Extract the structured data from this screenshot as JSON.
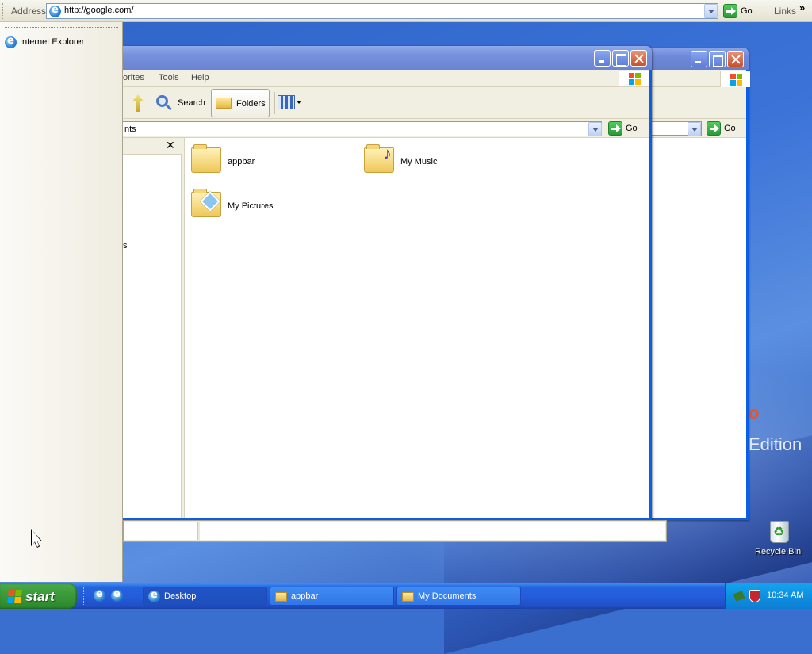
{
  "address_band": {
    "label": "Address",
    "url": "http://google.com/",
    "go_label": "Go",
    "links_label": "Links",
    "more_chevron": "»"
  },
  "appbar": {
    "items": [
      {
        "label": "Internet Explorer",
        "icon": "ie-icon"
      }
    ]
  },
  "explorer_front": {
    "menu": [
      {
        "label": "orites"
      },
      {
        "label": "Tools"
      },
      {
        "label": "Help"
      }
    ],
    "toolbar": {
      "search_label": "Search",
      "folders_label": "Folders"
    },
    "address": {
      "value": "nts",
      "go_label": "Go"
    },
    "folder_pane": {
      "close": "✕",
      "fragment": "s"
    },
    "items": [
      {
        "label": "appbar",
        "icon": "folder-icon"
      },
      {
        "label": "My Music",
        "icon": "music-folder-icon"
      },
      {
        "label": "My Pictures",
        "icon": "pictures-folder-icon"
      }
    ]
  },
  "explorer_back": {
    "go_label": "Go"
  },
  "desktop": {
    "edition_text": "Edition",
    "recycle_bin_label": "Recycle Bin"
  },
  "taskbar": {
    "start_label": "start",
    "tasks": [
      {
        "label": "Desktop",
        "icon": "ie-icon"
      },
      {
        "label": "appbar",
        "icon": "folder-icon"
      },
      {
        "label": "My Documents",
        "icon": "folder-icon"
      }
    ],
    "clock": "10:34 AM"
  },
  "colors": {
    "xp_blue": "#245ddb",
    "start_green": "#3c9b3c",
    "window_bg": "#f1efe2"
  }
}
